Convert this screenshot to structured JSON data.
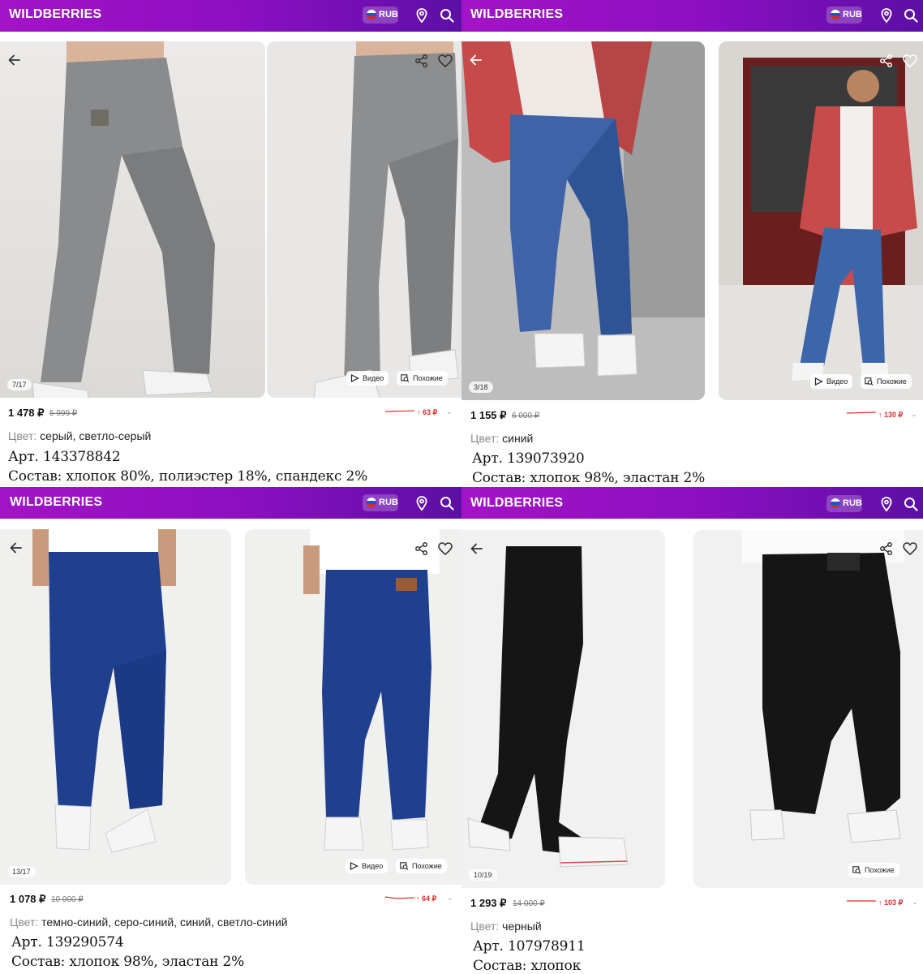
{
  "app": {
    "brand": "WILDBERRIES",
    "currency": "RUB"
  },
  "colors": {
    "header_start": "#a313c6",
    "header_end": "#5c0fa5",
    "price_up": "#e02b2b"
  },
  "labels": {
    "video": "Видео",
    "similar": "Похожие",
    "color_label": "Цвет:"
  },
  "icons": [
    "back-arrow-icon",
    "share-icon",
    "heart-icon",
    "location-pin-icon",
    "search-icon",
    "play-icon",
    "similar-search-icon",
    "chevron-down-icon",
    "arrow-up-icon"
  ],
  "products": [
    {
      "counter": "7/17",
      "price": "1 478 ₽",
      "old_price": "5 999 ₽",
      "change": "↑ 63 ₽",
      "color": "серый, светло-серый",
      "article": "Арт. 143378842",
      "composition": "Состав: хлопок 80%, полиэстер 18%, спандекс 2%",
      "has_video": true
    },
    {
      "counter": "3/18",
      "price": "1 155 ₽",
      "old_price": "6 000 ₽",
      "change": "↑ 130 ₽",
      "color": "синий",
      "article": "Арт. 139073920",
      "composition": "Состав: хлопок 98%, эластан 2%",
      "has_video": true
    },
    {
      "counter": "13/17",
      "price": "1 078 ₽",
      "old_price": "10 000 ₽",
      "change": "↑ 64 ₽",
      "color": "темно-синий, серо-синий, синий, светло-синий",
      "article": "Арт. 139290574",
      "composition": "Состав: хлопок 98%, эластан 2%",
      "has_video": true
    },
    {
      "counter": "10/19",
      "price": "1 293 ₽",
      "old_price": "14 000 ₽",
      "change": "↑ 103 ₽",
      "color": "черный",
      "article": "Арт. 107978911",
      "composition": "Состав: хлопок",
      "has_video": false
    }
  ]
}
